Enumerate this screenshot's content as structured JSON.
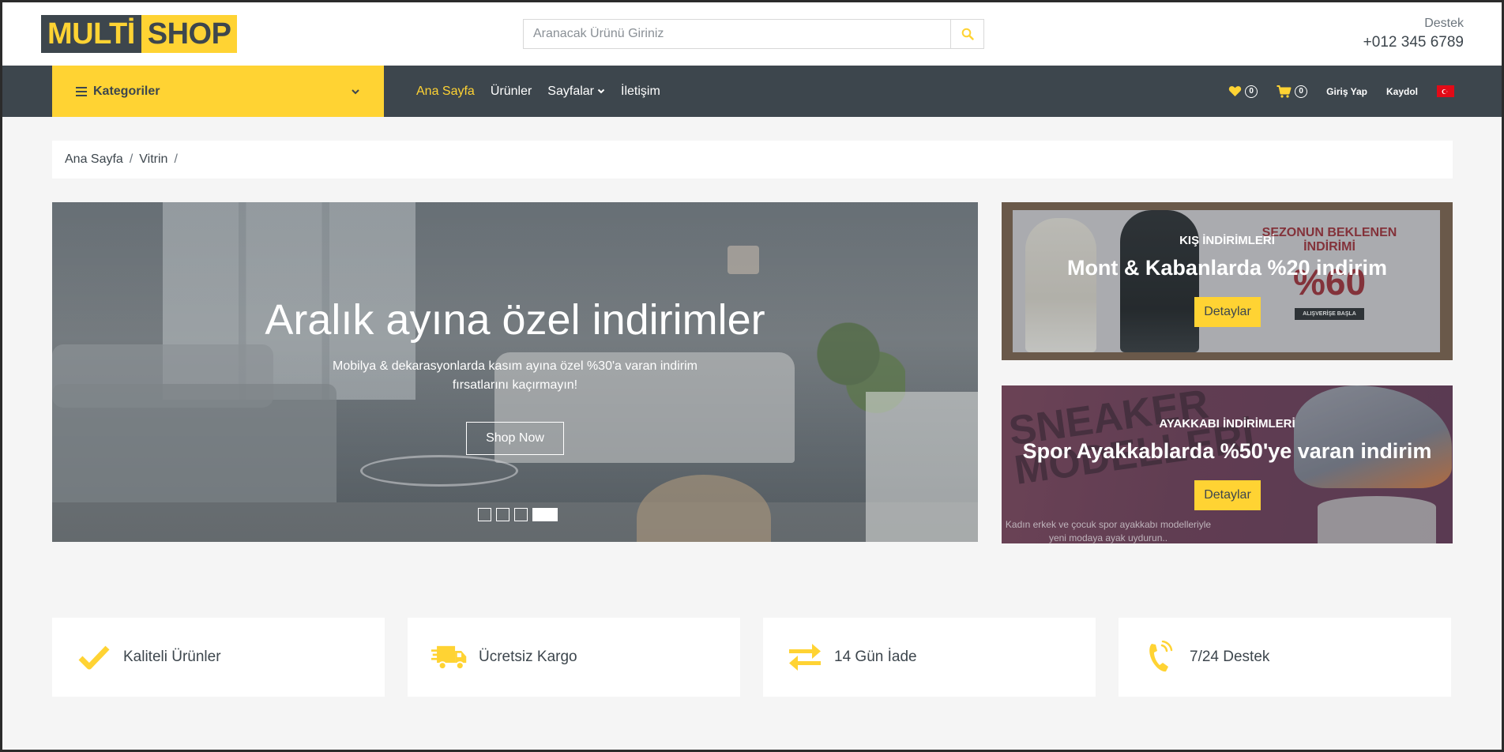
{
  "header": {
    "logo_part1": "MULTİ",
    "logo_part2": "SHOP",
    "search_placeholder": "Aranacak Ürünü Giriniz",
    "support_label": "Destek",
    "support_phone": "+012 345 6789"
  },
  "nav": {
    "categories_label": "Kategoriler",
    "links": [
      {
        "label": "Ana Sayfa",
        "active": true
      },
      {
        "label": "Ürünler"
      },
      {
        "label": "Sayfalar"
      },
      {
        "label": "İletişim"
      }
    ],
    "wishlist_count": "0",
    "cart_count": "0",
    "login_label": "Giriş Yap",
    "register_label": "Kaydol"
  },
  "breadcrumb": {
    "items": [
      "Ana Sayfa",
      "Vitrin"
    ]
  },
  "slider": {
    "title": "Aralık ayına özel indirimler",
    "subtitle": "Mobilya & dekarasyonlarda kasım ayına özel %30'a varan indirim fırsatlarını kaçırmayın!",
    "button_label": "Shop Now",
    "dots_total": 4,
    "dot_active": 4
  },
  "offers": [
    {
      "tag": "KIŞ İNDİRİMLERİ",
      "title": "Mont & Kabanlarda %20 indirim",
      "button_label": "Detaylar",
      "image_text_1": "SEZONUN BEKLENEN İNDİRİMİ",
      "image_text_2": "%60",
      "image_text_3": "ALIŞVERİŞE BAŞLA"
    },
    {
      "tag": "AYAKKABI İNDİRİMLERİ",
      "title": "Spor Ayakkablarda %50'ye varan indirim",
      "button_label": "Detaylar",
      "image_text_1": "SNEAKER MODELLERİ",
      "image_text_2": "Kadın erkek ve çocuk spor ayakkabı modelleriyle yeni modaya ayak uydurun.."
    }
  ],
  "features": [
    {
      "label": "Kaliteli Ürünler",
      "icon": "check-icon"
    },
    {
      "label": "Ücretsiz Kargo",
      "icon": "truck-icon"
    },
    {
      "label": "14 Gün İade",
      "icon": "exchange-icon"
    },
    {
      "label": "7/24 Destek",
      "icon": "phone-volume-icon"
    }
  ],
  "colors": {
    "primary": "#ffd333",
    "dark": "#3d464d",
    "light_bg": "#f5f5f5",
    "flag_red": "#e30a17"
  }
}
